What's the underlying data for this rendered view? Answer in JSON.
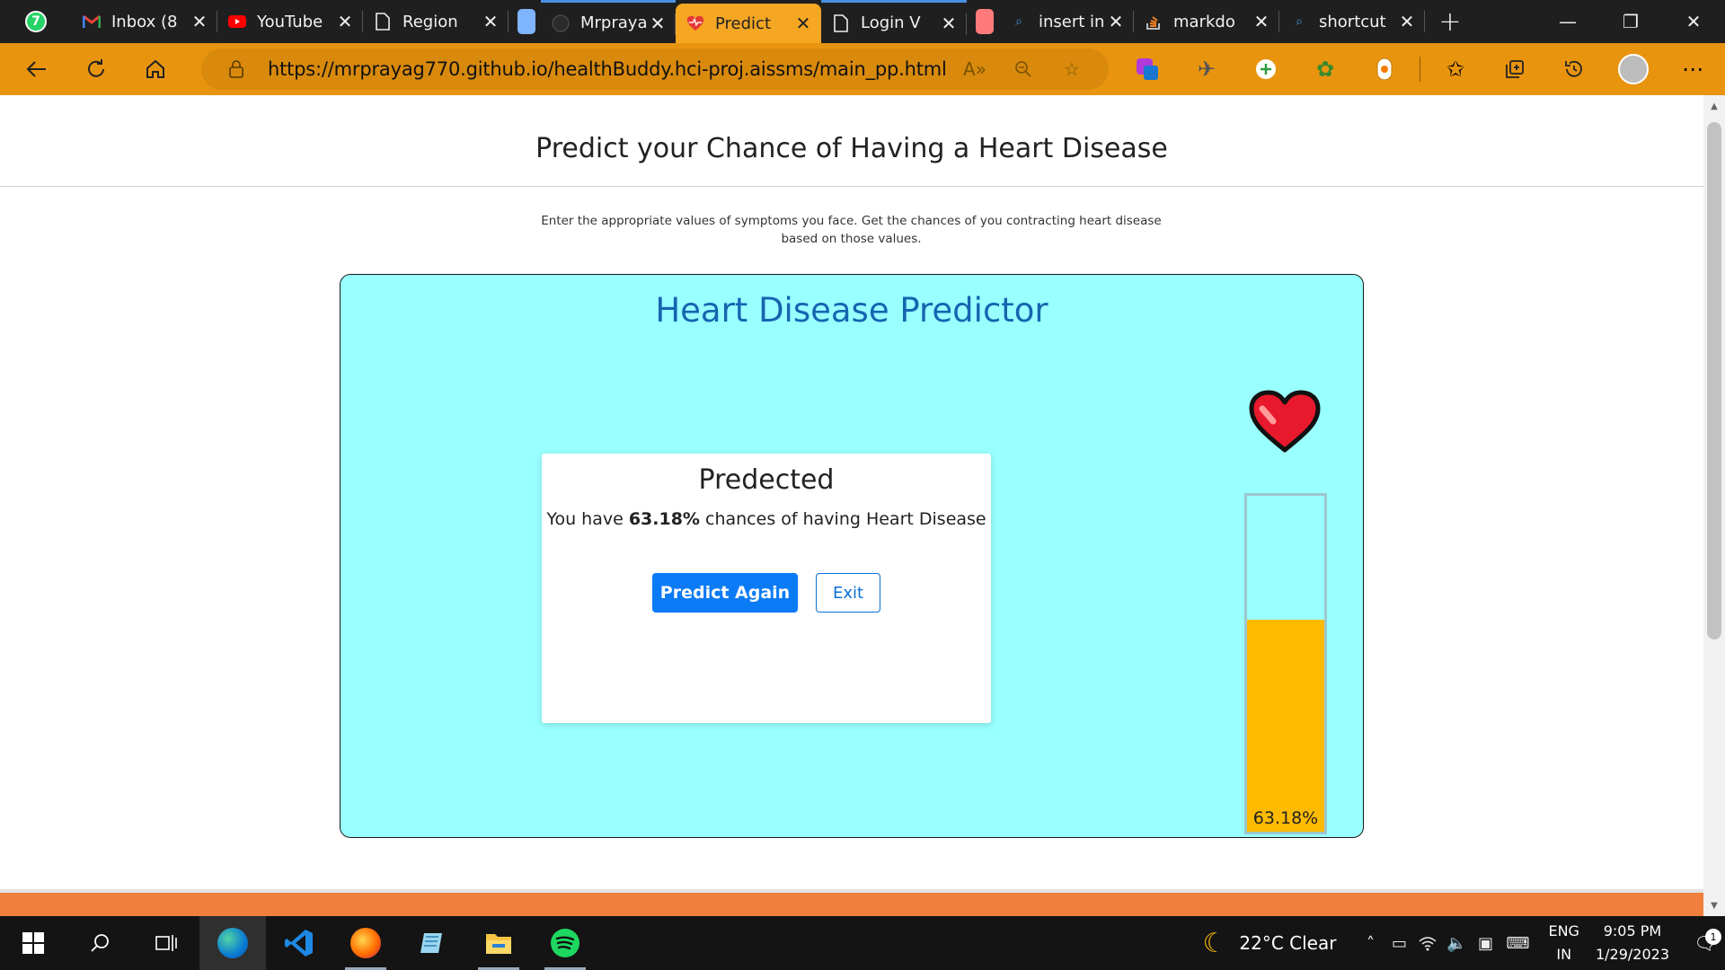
{
  "browser": {
    "pinned_tab": {
      "icon": "whatsapp-icon",
      "badge": "7"
    },
    "tabs": [
      {
        "title": "Inbox (8",
        "icon": "gmail-icon"
      },
      {
        "title": "YouTube",
        "icon": "youtube-icon"
      },
      {
        "title": "Region",
        "icon": "page-icon"
      },
      {
        "title": "Mrpraya",
        "icon": "github-icon"
      },
      {
        "title": "Predict",
        "icon": "heart-pulse-icon",
        "active": true
      },
      {
        "title": "Login V",
        "icon": "page-icon"
      },
      {
        "title": "insert in",
        "icon": "search-icon"
      },
      {
        "title": "markdo",
        "icon": "stackoverflow-icon"
      },
      {
        "title": "shortcut",
        "icon": "search-icon"
      }
    ],
    "url": "https://mrprayag770.github.io/healthBuddy.hci-proj.aissms/main_pp.html",
    "accent_color": "#e8940f"
  },
  "page": {
    "title": "Predict your Chance of Having a Heart Disease",
    "description": "Enter the appropriate values of symptoms you face. Get the chances of you contracting heart disease based on those values.",
    "predictor_title": "Heart Disease Predictor",
    "result": {
      "heading": "Predected",
      "text_before": "You have ",
      "percentage": "63.18%",
      "text_after": " chances of having Heart Disease",
      "predict_again_label": "Predict Again",
      "exit_label": "Exit"
    },
    "meter": {
      "label": "63.18%",
      "fraction": 0.6318,
      "fill_color": "#ffbb00"
    },
    "panel_color": "#99ffff",
    "footer_color": "#f07f3c"
  },
  "taskbar": {
    "apps": [
      "edge-icon",
      "vscode-icon",
      "firefox-icon",
      "notepad-icon",
      "file-explorer-icon",
      "spotify-icon"
    ],
    "weather": {
      "temp": "22°C",
      "condition": "Clear"
    },
    "lang": {
      "line1": "ENG",
      "line2": "IN"
    },
    "clock": {
      "time": "9:05 PM",
      "date": "1/29/2023"
    },
    "notifications": "1"
  }
}
